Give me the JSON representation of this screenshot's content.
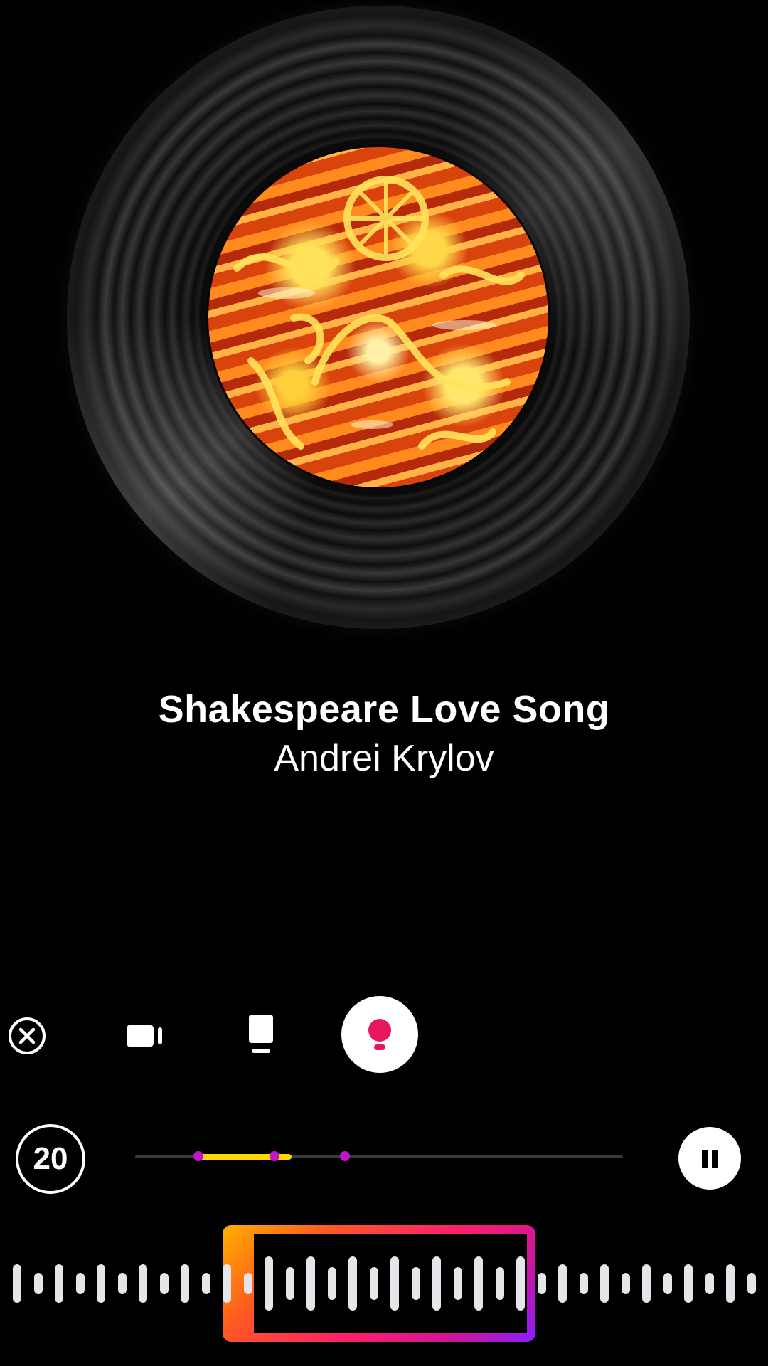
{
  "song": {
    "title": "Shakespeare Love Song",
    "artist": "Andrei Krylov"
  },
  "modes": {
    "items": [
      {
        "name": "close",
        "icon": "close-circle-icon"
      },
      {
        "name": "video",
        "icon": "video-camera-icon"
      },
      {
        "name": "photo",
        "icon": "photo-frame-icon"
      },
      {
        "name": "live",
        "icon": "live-bulb-icon",
        "selected": true
      }
    ]
  },
  "playback": {
    "timer_label": "20",
    "progress_fraction": 0.33,
    "highlight_start_fraction": 0.13,
    "highlight_end_fraction": 0.32,
    "markers_fraction": [
      0.13,
      0.285,
      0.43
    ],
    "state": "playing"
  },
  "colors": {
    "accent_pink": "#e8155f",
    "progress_yellow": "#ffd600",
    "marker_purple": "#c316c8",
    "selection_gradient": [
      "#ffb000",
      "#ff1f6b",
      "#8a1cff"
    ]
  }
}
